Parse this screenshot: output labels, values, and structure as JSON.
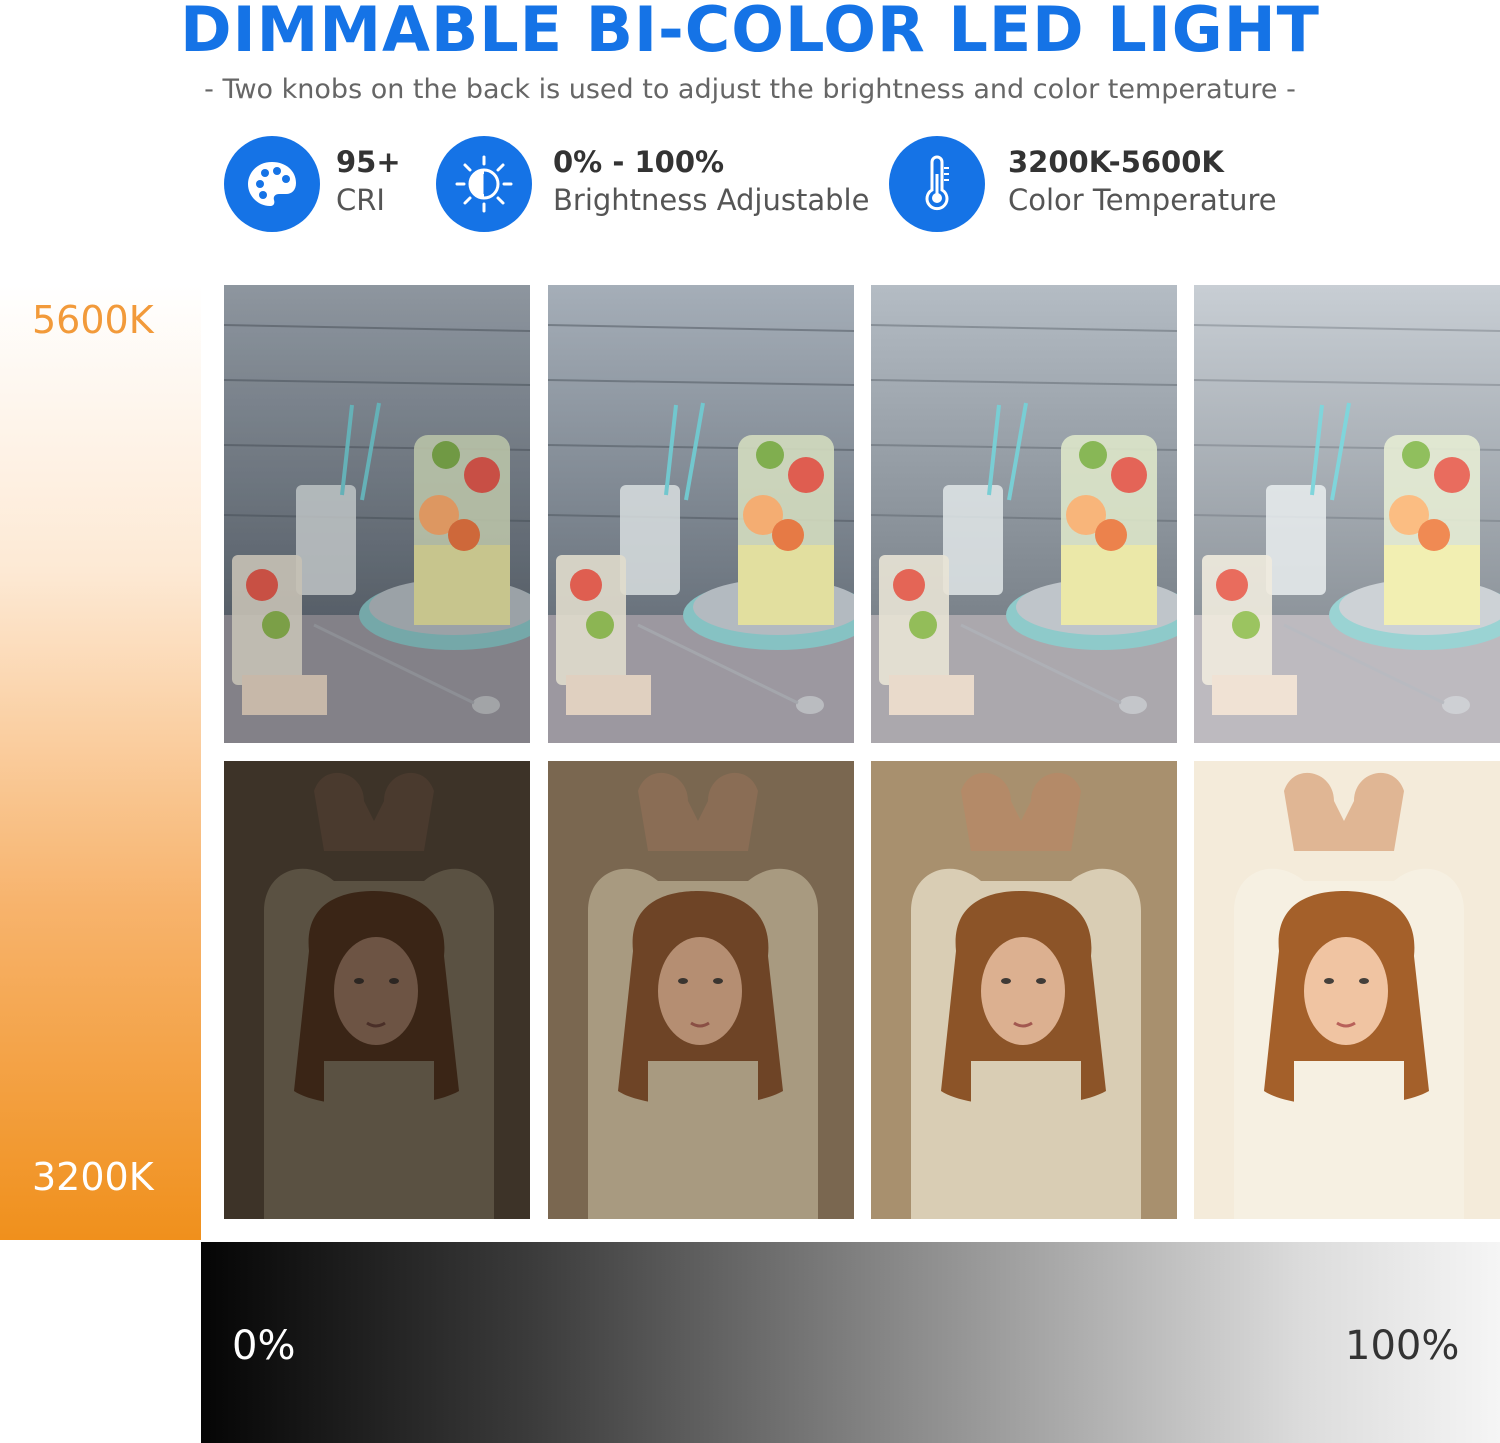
{
  "header": {
    "title": "DIMMABLE BI-COLOR LED LIGHT",
    "subtitle": "- Two knobs on the back is used to adjust the brightness and color temperature -"
  },
  "features": [
    {
      "value": "95+",
      "label": "CRI",
      "icon": "palette-icon"
    },
    {
      "value": "0% - 100%",
      "label": "Brightness Adjustable",
      "icon": "brightness-icon"
    },
    {
      "value": "3200K-5600K",
      "label": "Color Temperature",
      "icon": "thermometer-icon"
    }
  ],
  "temperature_scale": {
    "top_label": "5600K",
    "bottom_label": "3200K"
  },
  "brightness_scale": {
    "left_label": "0%",
    "right_label": "100%"
  },
  "colors": {
    "accent": "#1573e6",
    "warm": "#f0901c",
    "top_label": "#f29a3a",
    "bottom_label": "#ffffff"
  },
  "photo_rows": [
    {
      "subject": "drinks still life",
      "brightness_levels": [
        0.55,
        0.65,
        0.8,
        0.95
      ]
    },
    {
      "subject": "girl portrait",
      "brightness_levels": [
        0.35,
        0.55,
        0.75,
        1.0
      ]
    }
  ]
}
